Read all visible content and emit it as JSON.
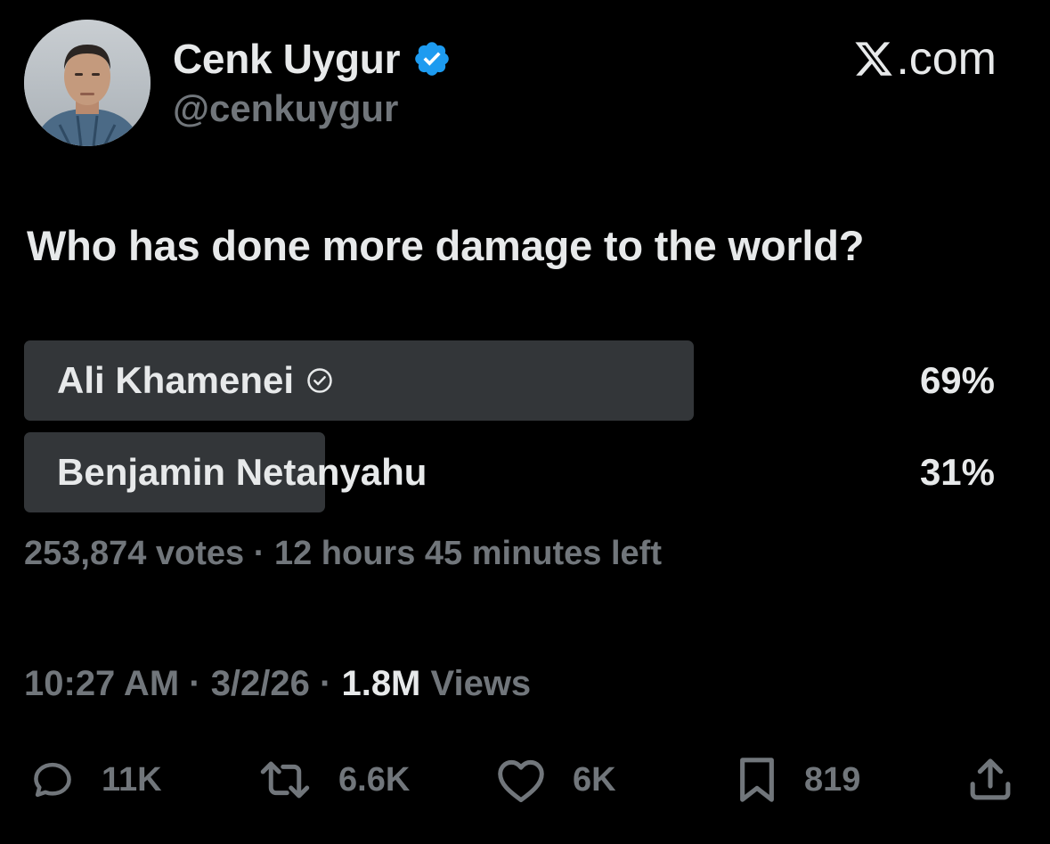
{
  "author": {
    "display_name": "Cenk Uygur",
    "handle": "@cenkuygur",
    "verified_icon": "verified-badge-icon",
    "avatar": "profile-photo"
  },
  "brand": {
    "text": ".com",
    "icon": "x-logo-icon"
  },
  "tweet": {
    "text": "Who has done more damage to the world?"
  },
  "poll": {
    "options": [
      {
        "label": "Ali Khamenei",
        "percent": "69%",
        "fill_fraction": 0.69,
        "selected": true
      },
      {
        "label": "Benjamin Netanyahu",
        "percent": "31%",
        "fill_fraction": 0.31,
        "selected": false
      }
    ],
    "votes": "253,874 votes",
    "separator": " · ",
    "time_left": "12 hours 45 minutes left"
  },
  "meta": {
    "time": "10:27 AM",
    "date": "3/2/26",
    "separator": " · ",
    "views_count": "1.8M",
    "views_label": " Views"
  },
  "actions": {
    "replies": "11K",
    "reposts": "6.6K",
    "likes": "6K",
    "bookmarks": "819"
  },
  "colors": {
    "background": "#000000",
    "text_primary": "#e7e9ea",
    "text_secondary": "#71767b",
    "poll_bar": "#333639",
    "verified_blue": "#1d9bf0"
  }
}
